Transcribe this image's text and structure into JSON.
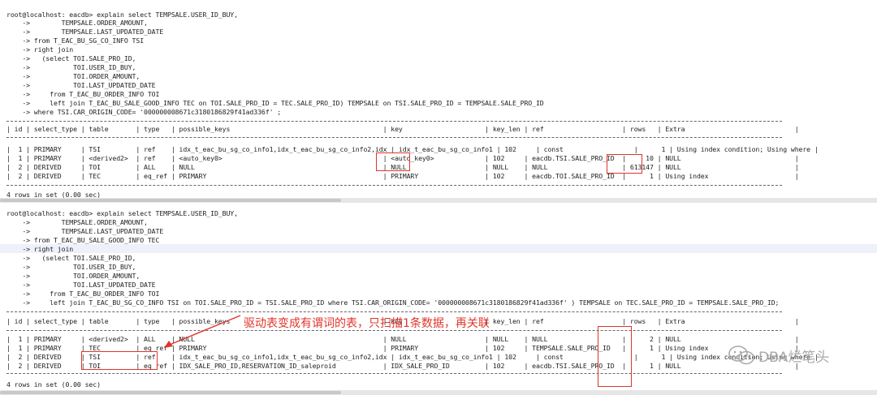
{
  "session1": {
    "lines": [
      "root@localhost: eacdb> explain select TEMPSALE.USER_ID_BUY,",
      "    ->        TEMPSALE.ORDER_AMOUNT,",
      "    ->        TEMPSALE.LAST_UPDATED_DATE",
      "    -> from T_EAC_BU_SG_CO_INFO TSI",
      "    -> right join",
      "    ->   (select TOI.SALE_PRO_ID,",
      "    ->           TOI.USER_ID_BUY,",
      "    ->           TOI.ORDER_AMOUNT,",
      "    ->           TOI.LAST_UPDATED_DATE",
      "    ->     from T_EAC_BU_ORDER_INFO TOI",
      "    ->     left join T_EAC_BU_SALE_GOOD_INFO TEC on TOI.SALE_PRO_ID = TEC.SALE_PRO_ID) TEMPSALE on TSI.SALE_PRO_ID = TEMPSALE.SALE_PRO_ID",
      "    -> where TSI.CAR_ORIGIN_CODE= '000000008671c3180186829f41ad336f' ;"
    ],
    "header": "| id | select_type | table       | type   | possible_keys                                       | key                     | key_len | ref                    | rows   | Extra                            |",
    "rows": [
      "|  1 | PRIMARY     | TSI         | ref    | idx_t_eac_bu_sg_co_info1,idx_t_eac_bu_sg_co_info2,idx | idx_t_eac_bu_sg_co_info1 | 102     | const                  |      1 | Using index condition; Using where |",
      "|  1 | PRIMARY     | <derived2>  | ref    | <auto_key0>                                         | <auto_key0>             | 102     | eacdb.TSI.SALE_PRO_ID  |     10 | NULL                             |",
      "|  2 | DERIVED     | TOI         | ALL    | NULL                                                | NULL                    | NULL    | NULL                   | 613147 | NULL                             |",
      "|  2 | DERIVED     | TEC         | eq_ref | PRIMARY                                             | PRIMARY                 | 102     | eacdb.TOI.SALE_PRO_ID  |      1 | Using index                      |"
    ],
    "footer": "4 rows in set (0.00 sec)"
  },
  "session2": {
    "lines": [
      "root@localhost: eacdb> explain select TEMPSALE.USER_ID_BUY,",
      "    ->        TEMPSALE.ORDER_AMOUNT,",
      "    ->        TEMPSALE.LAST_UPDATED_DATE",
      "    -> from T_EAC_BU_SALE_GOOD_INFO TEC",
      "    -> right join",
      "    ->   (select TOI.SALE_PRO_ID,",
      "    ->           TOI.USER_ID_BUY,",
      "    ->           TOI.ORDER_AMOUNT,",
      "    ->           TOI.LAST_UPDATED_DATE",
      "    ->     from T_EAC_BU_ORDER_INFO TOI",
      "    ->     left join T_EAC_BU_SG_CO_INFO TSI on TOI.SALE_PRO_ID = TSI.SALE_PRO_ID where TSI.CAR_ORIGIN_CODE= '000000008671c3180186829f41ad336f' ) TEMPSALE on TEC.SALE_PRO_ID = TEMPSALE.SALE_PRO_ID;"
    ],
    "header": "| id | select_type | table       | type   | possible_keys                                       | key                     | key_len | ref                    | rows   | Extra                            |",
    "rows": [
      "|  1 | PRIMARY     | <derived2>  | ALL    | NULL                                                | NULL                    | NULL    | NULL                   |      2 | NULL                             |",
      "|  1 | PRIMARY     | TEC         | eq_ref | PRIMARY                                             | PRIMARY                 | 102     | TEMPSALE.SALE_PRO_ID   |      1 | Using index                      |",
      "|  2 | DERIVED     | TSI         | ref    | idx_t_eac_bu_sg_co_info1,idx_t_eac_bu_sg_co_info2,idx | idx_t_eac_bu_sg_co_info1 | 102     | const                  |      1 | Using index condition; Using where |",
      "|  2 | DERIVED     | TOI         | eq_ref | IDX_SALE_PRO_ID,RESERVATION_ID_saleproid            | IDX_SALE_PRO_ID         | 102     | eacdb.TSI.SALE_PRO_ID  |      1 | NULL                             |"
    ],
    "footer": "4 rows in set (0.00 sec)"
  },
  "annotation": "驱动表变成有谓词的表，只扫描1条数据，再关联",
  "watermark": "DBA烂笔头",
  "colors": {
    "highlight_box": "#e0352b",
    "watermark": "#a9a9a9",
    "current_line": "#eef0fa"
  }
}
